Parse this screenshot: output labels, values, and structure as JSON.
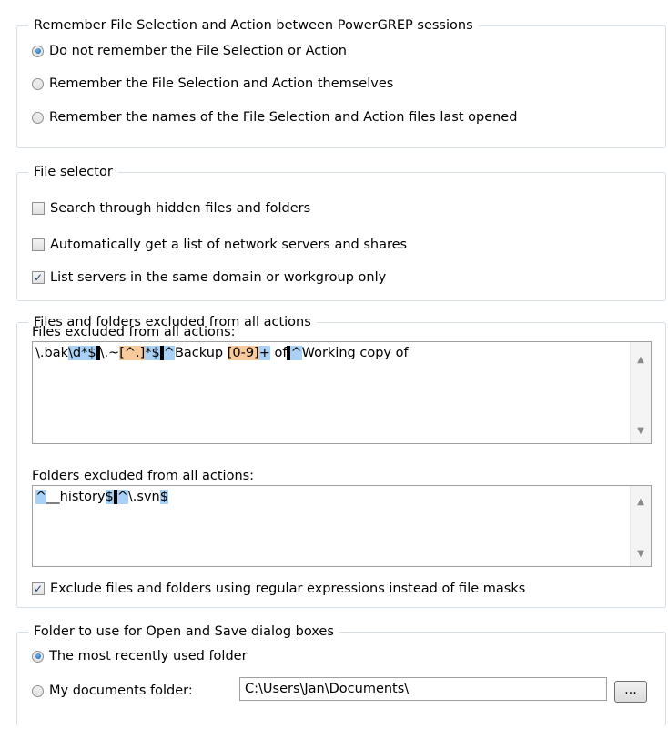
{
  "remember": {
    "title": "Remember File Selection and Action between PowerGREP sessions",
    "options": [
      {
        "label": "Do not remember the File Selection or Action",
        "selected": true
      },
      {
        "label": "Remember the File Selection and Action themselves",
        "selected": false
      },
      {
        "label": "Remember the names of the File Selection and Action files last opened",
        "selected": false
      }
    ]
  },
  "file_selector": {
    "title": "File selector",
    "options": [
      {
        "label": "Search through hidden files and folders",
        "checked": false
      },
      {
        "label": "Automatically get a list of network servers and shares",
        "checked": false
      },
      {
        "label": "List servers in the same domain or workgroup only",
        "checked": true
      }
    ]
  },
  "excluded": {
    "title": "Files and folders excluded from all actions",
    "files_label": "Files excluded from all actions:",
    "files_tokens": [
      "\\.bak",
      "\\d*$",
      "\\.~",
      "[^.]",
      "*$",
      "^",
      "Backup ",
      "[0-9]",
      "+",
      " of",
      "^",
      "Working copy of"
    ],
    "folders_label": "Folders excluded from all actions:",
    "folders_tokens": [
      "^",
      "__history",
      "$",
      "^",
      "\\.svn",
      "$"
    ],
    "regex_option": {
      "label": "Exclude files and folders using regular expressions instead of file masks",
      "checked": true
    }
  },
  "folder": {
    "title": "Folder to use for Open and Save dialog boxes",
    "recent_label": "The most recently used folder",
    "recent_selected": true,
    "mydocs_label": "My documents folder:",
    "mydocs_selected": false,
    "path_value": "C:\\Users\\Jan\\Documents\\",
    "browse_label": "..."
  },
  "icons": {
    "check_mark": "✓",
    "scroll_up": "▲",
    "scroll_down": "▼"
  }
}
